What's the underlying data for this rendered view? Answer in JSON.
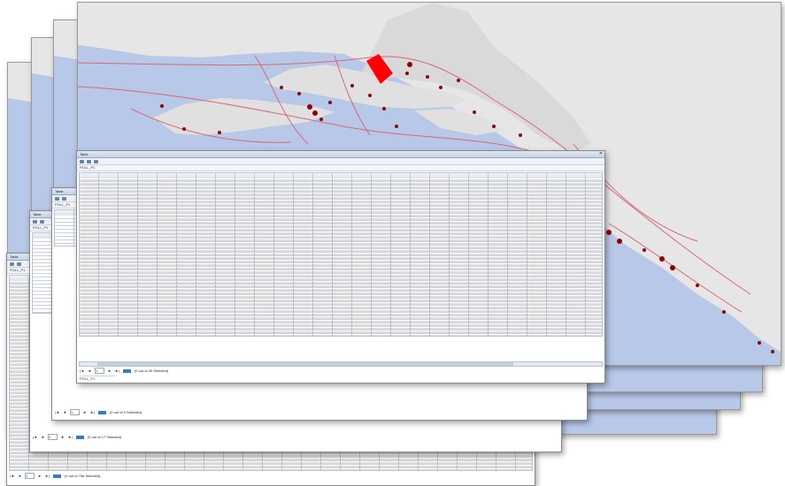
{
  "title": "Table",
  "layer_name": "POLL_P1",
  "nav_symbols": {
    "first": "|◄",
    "prev": "◄",
    "next": "►",
    "last": "►|"
  },
  "windows": [
    {
      "status": "(0 out of 756 Selected)",
      "nav_value": "1"
    },
    {
      "status": "(0 out of 17 Selected)",
      "nav_value": "1"
    },
    {
      "status": "(0 out of 9 Selected)",
      "nav_value": "1"
    },
    {
      "status": "(0 out of 30 Selected)",
      "nav_value": "1"
    }
  ],
  "colors": {
    "sea": "#b8c8e8",
    "land": "#e6e6e6",
    "highlight": "#ff0000",
    "points": "#8b0000",
    "lines": "#d9667a",
    "selection": "#3c78c8"
  },
  "icons": [
    "close-icon",
    "table-options-icon",
    "select-by-attributes-icon",
    "navigation-first-icon",
    "navigation-prev-icon",
    "navigation-next-icon",
    "navigation-last-icon"
  ]
}
